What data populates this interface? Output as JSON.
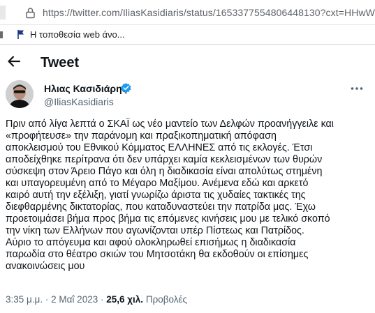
{
  "browser": {
    "url": "https://twitter.com/IliasKasidiaris/status/1653377554806448130?cxt=HHwW",
    "favorites": [
      {
        "label": "Η τοποθεσία web άνο..."
      }
    ]
  },
  "header": {
    "title": "Tweet"
  },
  "author": {
    "name": "Ηλιας Κασιδιάρης",
    "handle": "@IliasKasidiaris",
    "verified": true
  },
  "tweet": {
    "text": "Πριν από λίγα λεπτά ο ΣΚΑΪ ως νέο μαντείο των Δελφών προανήγγειλε και\n«προφήτευσε» την παράνομη και πραξικοπηματική απόφαση\nαποκλεισμού του Εθνικού Κόμματος ΕΛΛΗΝΕΣ από τις εκλογές. Έτσι\nαποδείχθηκε περίτρανα ότι δεν υπάρχει καμία κεκλεισμένων των θυρών\nσύσκεψη στον Άρειο Πάγο και όλη η διαδικασία είναι απολύτως στημένη\nκαι υπαγορευμένη από το Μέγαρο Μαξίμου. Ανέμενα εδώ και αρκετό\nκαιρό αυτή την εξέλιξη, γιατί γνωρίζω άριστα τις χυδαίες τακτικές της\nδιεφθαρμένης δικτατορίας, που καταδυναστεύει την πατρίδα μας. Έχω\nπροετοιμάσει βήμα προς βήμα τις επόμενες κινήσεις μου με τελικό σκοπό\nτην νίκη των Ελλήνων που αγωνίζονται υπέρ Πίστεως και Πατρίδος.\nΑύριο το απόγευμα και αφού ολοκληρωθεί επισήμως η διαδικασία\nπαρωδία στο θέατρο σκιών του Μητσοτάκη θα εκδοθούν οι επίσημες\nανακοινώσεις μου",
    "time": "3:35 μ.μ.",
    "separator": "·",
    "date": "2 Μαΐ 2023",
    "views_count": "25,6 χιλ.",
    "views_label": "Προβολές"
  },
  "colors": {
    "verified": "#1d9bf0",
    "secondary_text": "#536471",
    "primary_text": "#0f1419"
  }
}
